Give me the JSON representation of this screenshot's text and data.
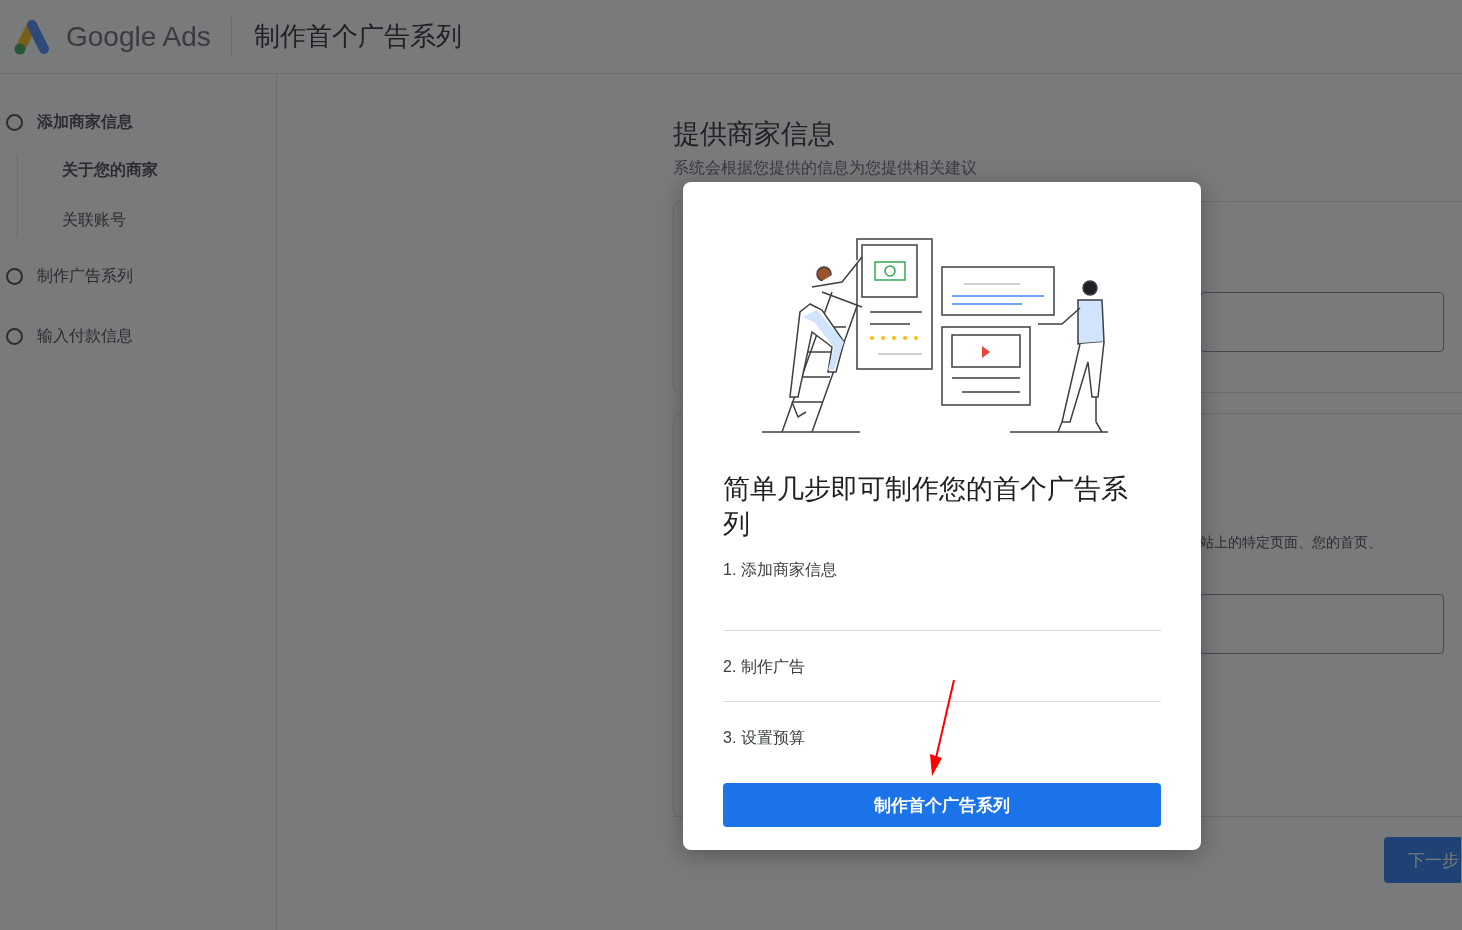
{
  "header": {
    "product_name": "Google Ads",
    "page_title": "制作首个广告系列"
  },
  "sidebar": {
    "steps": [
      {
        "label": "添加商家信息",
        "selected": true,
        "children": [
          {
            "label": "关于您的商家",
            "selected": true
          },
          {
            "label": "关联账号",
            "selected": false
          }
        ]
      },
      {
        "label": "制作广告系列",
        "selected": false
      },
      {
        "label": "输入付款信息",
        "selected": false
      }
    ]
  },
  "main": {
    "title": "提供商家信息",
    "subtitle": "系统会根据您提供的信息为您提供相关建议",
    "card_description": "站上的特定页面、您的首页、",
    "next_button": "下一步"
  },
  "dialog": {
    "title": "简单几步即可制作您的首个广告系列",
    "steps": [
      "1. 添加商家信息",
      "2. 制作广告",
      "3. 设置预算"
    ],
    "primary_button": "制作首个广告系列"
  }
}
